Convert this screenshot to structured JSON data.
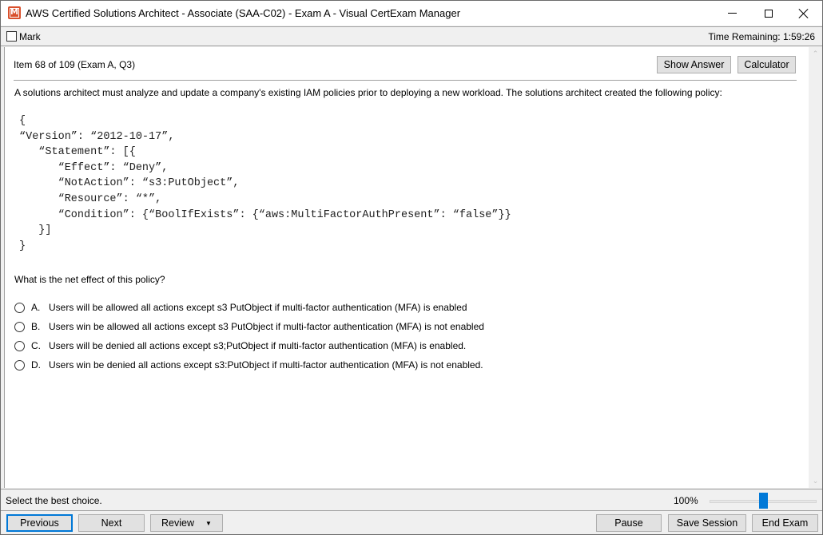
{
  "window": {
    "title": "AWS Certified Solutions Architect - Associate (SAA-C02) - Exam A - Visual CertExam Manager",
    "app_icon": "visual-certexam-logo-icon",
    "controls": [
      "minimize-icon",
      "maximize-icon",
      "close-icon"
    ]
  },
  "markbar": {
    "mark_label": "Mark",
    "mark_checked": false,
    "timer_label": "Time Remaining: 1:59:26"
  },
  "item": {
    "header": "Item 68 of 109  (Exam A, Q3)",
    "show_answer_label": "Show Answer",
    "calculator_label": "Calculator",
    "question": "A solutions architect must analyze and update a company's existing IAM policies prior to deploying a new workload. The solutions architect created the following policy:",
    "policy_code": "{\n“Version”: “2012-10-17”,\n   “Statement”: [{\n      “Effect”: “Deny”,\n      “NotAction”: “s3:PutObject”,\n      “Resource”: “*”,\n      “Condition”: {“BoolIfExists”: {“aws:MultiFactorAuthPresent”: “false”}}\n   }]\n}",
    "prompt": "What is the net effect of this policy?",
    "choices": [
      {
        "letter": "A.",
        "text": "Users will be allowed all actions except s3 PutObject if multi-factor authentication (MFA) is enabled",
        "selected": false
      },
      {
        "letter": "B.",
        "text": "Users win be allowed all actions except s3 PutObject if multi-factor authentication (MFA) is not enabled",
        "selected": false
      },
      {
        "letter": "C.",
        "text": "Users will be denied all actions except s3;PutObject if multi-factor authentication (MFA) is enabled.",
        "selected": false
      },
      {
        "letter": "D.",
        "text": "Users win be denied all actions except s3:PutObject if multi-factor authentication (MFA) is not enabled.",
        "selected": false
      }
    ]
  },
  "statusbar": {
    "instruction": "Select the best choice.",
    "zoom_label": "100%",
    "zoom_fraction": 0.5
  },
  "bottombar": {
    "previous_label": "Previous",
    "next_label": "Next",
    "review_label": "Review",
    "pause_label": "Pause",
    "save_session_label": "Save Session",
    "end_exam_label": "End Exam"
  },
  "colors": {
    "accent": "#0078d7",
    "app_icon": "#d9502c"
  }
}
